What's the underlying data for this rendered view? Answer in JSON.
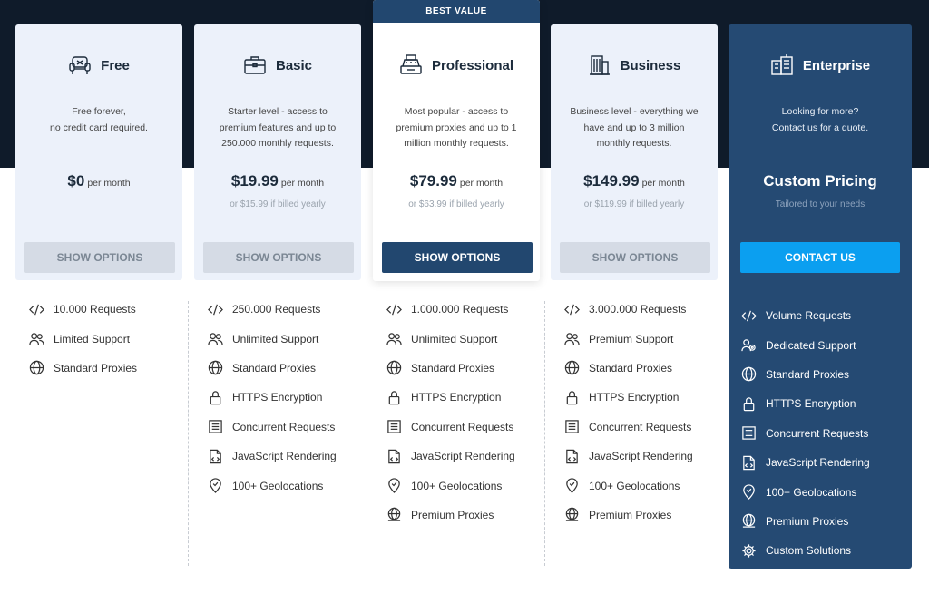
{
  "badge": "BEST VALUE",
  "plans": [
    {
      "name": "Free",
      "desc": [
        "Free forever,",
        "no credit card required."
      ],
      "price": "$0",
      "per": "per month",
      "yearly": "",
      "button": "SHOW OPTIONS",
      "features": [
        "10.000 Requests",
        "Limited Support",
        "Standard Proxies"
      ]
    },
    {
      "name": "Basic",
      "desc": [
        "Starter level - access to",
        "premium features and up to",
        "250.000 monthly requests."
      ],
      "price": "$19.99",
      "per": "per month",
      "yearly": "or $15.99 if billed yearly",
      "button": "SHOW OPTIONS",
      "features": [
        "250.000 Requests",
        "Unlimited Support",
        "Standard Proxies",
        "HTTPS Encryption",
        "Concurrent Requests",
        "JavaScript Rendering",
        "100+ Geolocations"
      ]
    },
    {
      "name": "Professional",
      "desc": [
        "Most popular - access to",
        "premium proxies and up to 1",
        "million monthly requests."
      ],
      "price": "$79.99",
      "per": "per month",
      "yearly": "or $63.99 if billed yearly",
      "button": "SHOW OPTIONS",
      "features": [
        "1.000.000 Requests",
        "Unlimited Support",
        "Standard Proxies",
        "HTTPS Encryption",
        "Concurrent Requests",
        "JavaScript Rendering",
        "100+ Geolocations",
        "Premium Proxies"
      ]
    },
    {
      "name": "Business",
      "desc": [
        "Business level - everything we",
        "have and up to 3 million",
        "monthly requests."
      ],
      "price": "$149.99",
      "per": "per month",
      "yearly": "or $119.99 if billed yearly",
      "button": "SHOW OPTIONS",
      "features": [
        "3.000.000 Requests",
        "Premium Support",
        "Standard Proxies",
        "HTTPS Encryption",
        "Concurrent Requests",
        "JavaScript Rendering",
        "100+ Geolocations",
        "Premium Proxies"
      ]
    },
    {
      "name": "Enterprise",
      "desc": [
        "Looking for more?",
        "Contact us for a quote."
      ],
      "price": "Custom Pricing",
      "per": "",
      "yearly": "Tailored to your needs",
      "button": "CONTACT US",
      "features": [
        "Volume Requests",
        "Dedicated Support",
        "Standard Proxies",
        "HTTPS Encryption",
        "Concurrent Requests",
        "JavaScript Rendering",
        "100+ Geolocations",
        "Premium Proxies",
        "Custom Solutions"
      ]
    }
  ],
  "icons": {
    "plans": [
      "armchair-icon",
      "briefcase-icon",
      "cash-register-icon",
      "office-building-icon",
      "city-buildings-icon"
    ],
    "features": [
      "code-icon",
      "users-icon",
      "globe-icon",
      "lock-icon",
      "document-lines-icon",
      "code-file-icon",
      "location-pin-icon",
      "globe-hand-icon",
      "gear-icon"
    ]
  },
  "colors": {
    "dark_band": "#0f1b2a",
    "card_bg": "#ecf1fa",
    "primary_button": "#22476f",
    "enterprise_bg": "#254a73",
    "contact_button": "#0b9ff0"
  }
}
